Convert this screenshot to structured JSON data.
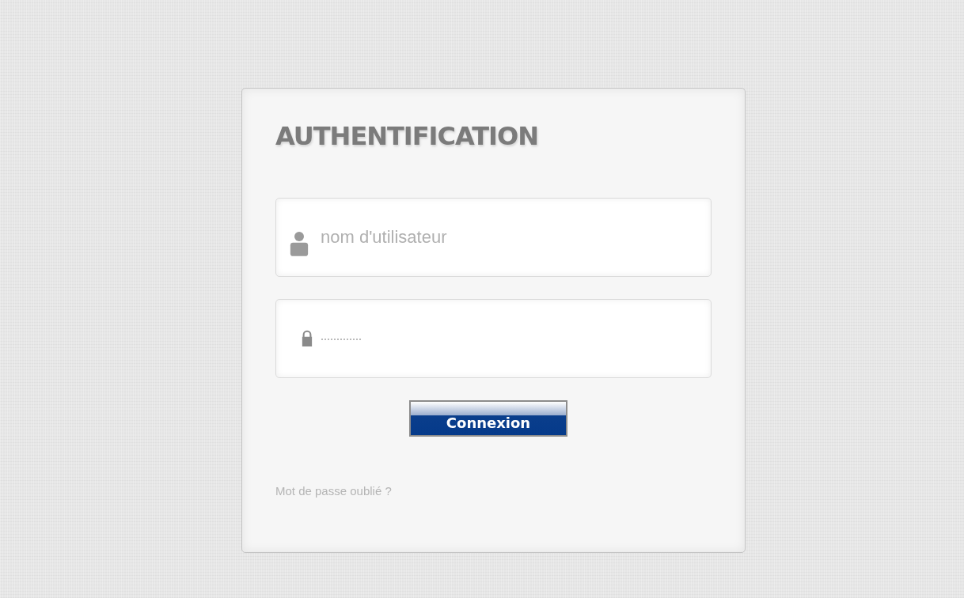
{
  "login_card": {
    "title": "AUTHENTIFICATION",
    "fields": [
      {
        "kind": "user",
        "placeholder": "nom d'utilisateur"
      },
      {
        "kind": "password",
        "placeholder": "·············"
      }
    ],
    "submit_button": "Connexion",
    "forgot_link": "Mot de passe oublié ?"
  }
}
